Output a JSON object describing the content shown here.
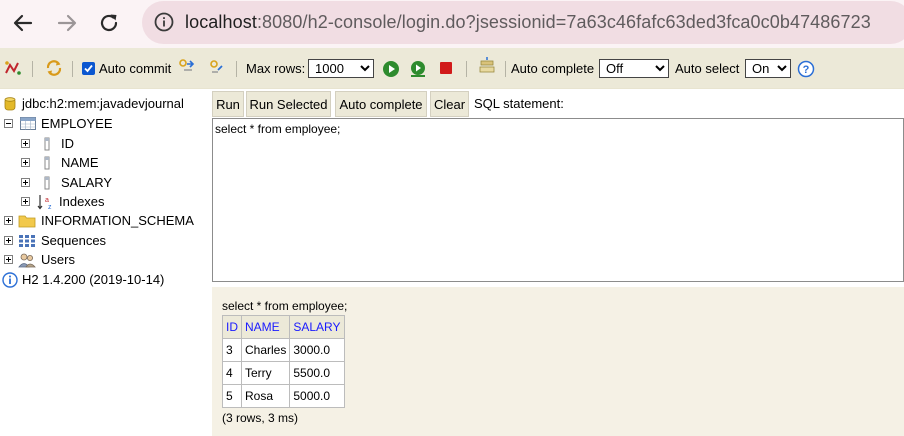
{
  "browser": {
    "url_host": "localhost",
    "url_rest": ":8080/h2-console/login.do?jsessionid=7a63c46fafc63ded3fca0c0b47486723",
    "icons": [
      "back-arrow-icon",
      "forward-arrow-icon",
      "reload-icon",
      "info-icon"
    ]
  },
  "toolbar": {
    "auto_commit_label": "Auto commit",
    "auto_commit_checked": true,
    "max_rows_label": "Max rows:",
    "max_rows_value": "1000",
    "auto_complete_label": "Auto complete",
    "auto_complete_value": "Off",
    "auto_select_label": "Auto select",
    "auto_select_value": "On",
    "colors": {
      "background": "#ece9d8",
      "run_green": "#2e8b2e",
      "stop_red": "#d11a1a",
      "help_blue": "#2b6fd6"
    }
  },
  "tree": {
    "connection": "jdbc:h2:mem:javadevjournal",
    "table": "EMPLOYEE",
    "columns": [
      "ID",
      "NAME",
      "SALARY"
    ],
    "indexes": "Indexes",
    "schema": "INFORMATION_SCHEMA",
    "sequences": "Sequences",
    "users": "Users",
    "version": "H2 1.4.200 (2019-10-14)"
  },
  "buttons": {
    "run": "Run",
    "run_selected": "Run Selected",
    "auto_complete": "Auto complete",
    "clear": "Clear",
    "sql_label": "SQL statement:"
  },
  "editor": {
    "text": "select * from employee;"
  },
  "result": {
    "statement": "select * from employee;",
    "headers": [
      "ID",
      "NAME",
      "SALARY"
    ],
    "rows": [
      [
        "3",
        "Charles",
        "3000.0"
      ],
      [
        "4",
        "Terry",
        "5500.0"
      ],
      [
        "5",
        "Rosa",
        "5000.0"
      ]
    ],
    "footer": "(3 rows, 3 ms)"
  }
}
